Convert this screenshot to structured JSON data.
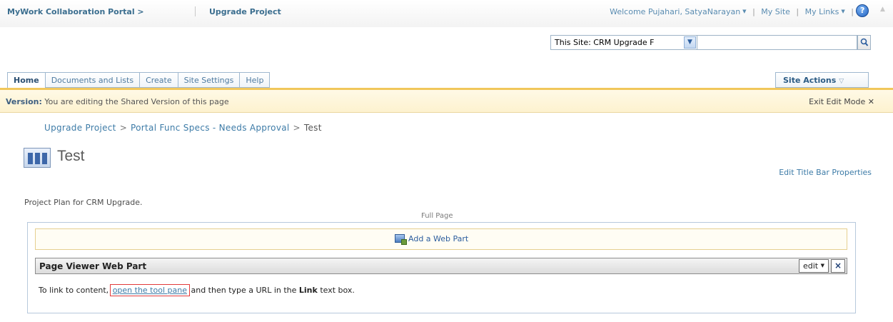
{
  "topbar": {
    "portal_crumb": "MyWork Collaboration Portal >",
    "site_crumb": "Upgrade Project",
    "welcome": "Welcome Pujahari, SatyaNarayan",
    "my_site": "My Site",
    "my_links": "My Links"
  },
  "search": {
    "scope": "This Site: CRM Upgrade F",
    "query": ""
  },
  "tabs": [
    "Home",
    "Documents and Lists",
    "Create",
    "Site Settings",
    "Help"
  ],
  "site_actions": "Site Actions",
  "version_bar": {
    "label": "Version:",
    "text": "You are editing the Shared Version of this page",
    "exit": "Exit Edit Mode"
  },
  "breadcrumb": [
    "Upgrade Project",
    "Portal Func Specs - Needs Approval",
    "Test"
  ],
  "page": {
    "title": "Test",
    "edit_title_bar": "Edit Title Bar Properties",
    "description": "Project Plan for CRM Upgrade.",
    "zone_label": "Full Page"
  },
  "zone": {
    "add_web_part": "Add a Web Part"
  },
  "webpart": {
    "title": "Page Viewer Web Part",
    "edit": "edit",
    "close": "×",
    "body_prefix": "To link to content,",
    "body_link": "open the tool pane",
    "body_mid": "and then type a URL in the",
    "body_bold": "Link",
    "body_suffix": "text box."
  }
}
